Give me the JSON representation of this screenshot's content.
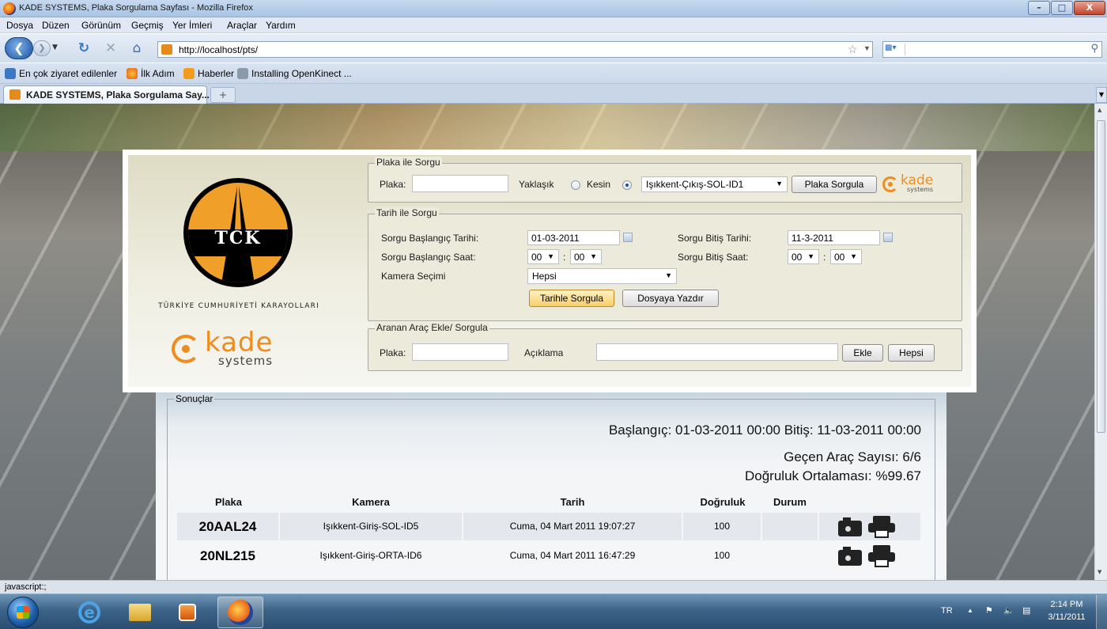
{
  "window": {
    "title": "KADE SYSTEMS, Plaka Sorgulama Sayfası - Mozilla Firefox",
    "min_symbol": "–",
    "max_symbol": "□",
    "close_symbol": "X"
  },
  "menu": [
    "Dosya",
    "Düzen",
    "Görünüm",
    "Geçmiş",
    "Yer İmleri",
    "Araçlar",
    "Yardım"
  ],
  "nav": {
    "url": "http://localhost/pts/",
    "search_placeholder": ""
  },
  "bookmarks": [
    "En çok ziyaret edilenler",
    "İlk Adım",
    "Haberler",
    "Installing OpenKinect ..."
  ],
  "tab": {
    "label": "KADE SYSTEMS, Plaka Sorgulama Say...",
    "new_tab_symbol": "+"
  },
  "logos": {
    "tck_text": "TCK",
    "tck_caption": "TÜRKİYE CUMHURİYETİ KARAYOLLARI",
    "kade_word": "kade",
    "kade_sub": "systems"
  },
  "plate_query": {
    "legend": "Plaka ile Sorgu",
    "plate_label": "Plaka:",
    "plate_value": "",
    "approx_label": "Yaklaşık",
    "exact_label": "Kesin",
    "selected_mode": "Kesin",
    "camera_selected": "Işıkkent-Çıkış-SOL-ID1",
    "button": "Plaka Sorgula"
  },
  "date_query": {
    "legend": "Tarih ile Sorgu",
    "start_date_label": "Sorgu Başlangıç Tarihi:",
    "start_date": "01-03-2011",
    "end_date_label": "Sorgu Bitiş Tarihi:",
    "end_date": "11-3-2011",
    "start_time_label": "Sorgu Başlangıç Saat:",
    "start_hour": "00",
    "start_minute": "00",
    "end_time_label": "Sorgu Bitiş Saat:",
    "end_hour": "00",
    "end_minute": "00",
    "time_sep": ":",
    "camera_label": "Kamera Seçimi",
    "camera_value": "Hepsi",
    "btn_query": "Tarihle Sorgula",
    "btn_export": "Dosyaya Yazdır"
  },
  "add_vehicle": {
    "legend": "Aranan Araç Ekle/ Sorgula",
    "plate_label": "Plaka:",
    "plate_value": "",
    "desc_label": "Açıklama",
    "desc_value": "",
    "btn_add": "Ekle",
    "btn_all": "Hepsi"
  },
  "results": {
    "legend": "Sonuçlar",
    "range_text": "Başlangıç: 01-03-2011 00:00 Bitiş: 11-03-2011 00:00",
    "count_text": "Geçen Araç Sayısı: 6/6",
    "accuracy_text": "Doğruluk Ortalaması: %99.67",
    "columns": [
      "Plaka",
      "Kamera",
      "Tarih",
      "Doğruluk",
      "Durum"
    ],
    "rows": [
      {
        "plate": "20AAL24",
        "camera": "Işıkkent-Giriş-SOL-ID5",
        "date": "Cuma, 04 Mart 2011 19:07:27",
        "accuracy": "100",
        "status": ""
      },
      {
        "plate": "20NL215",
        "camera": "Işıkkent-Giriş-ORTA-ID6",
        "date": "Cuma, 04 Mart 2011 16:47:29",
        "accuracy": "100",
        "status": ""
      }
    ]
  },
  "status": "javascript:;",
  "tray": {
    "lang": "TR",
    "time": "2:14 PM",
    "date": "3/11/2011"
  },
  "icons": [
    "firefox-icon",
    "back-icon",
    "forward-icon",
    "reload-icon",
    "stop-icon",
    "home-icon",
    "star-icon",
    "search-icon",
    "camera-icon",
    "printer-icon",
    "calendar-icon"
  ],
  "colors": {
    "kade_orange": "#f08c1e",
    "tck_orange": "#f0a028",
    "active_button": "#f6cf6a"
  }
}
